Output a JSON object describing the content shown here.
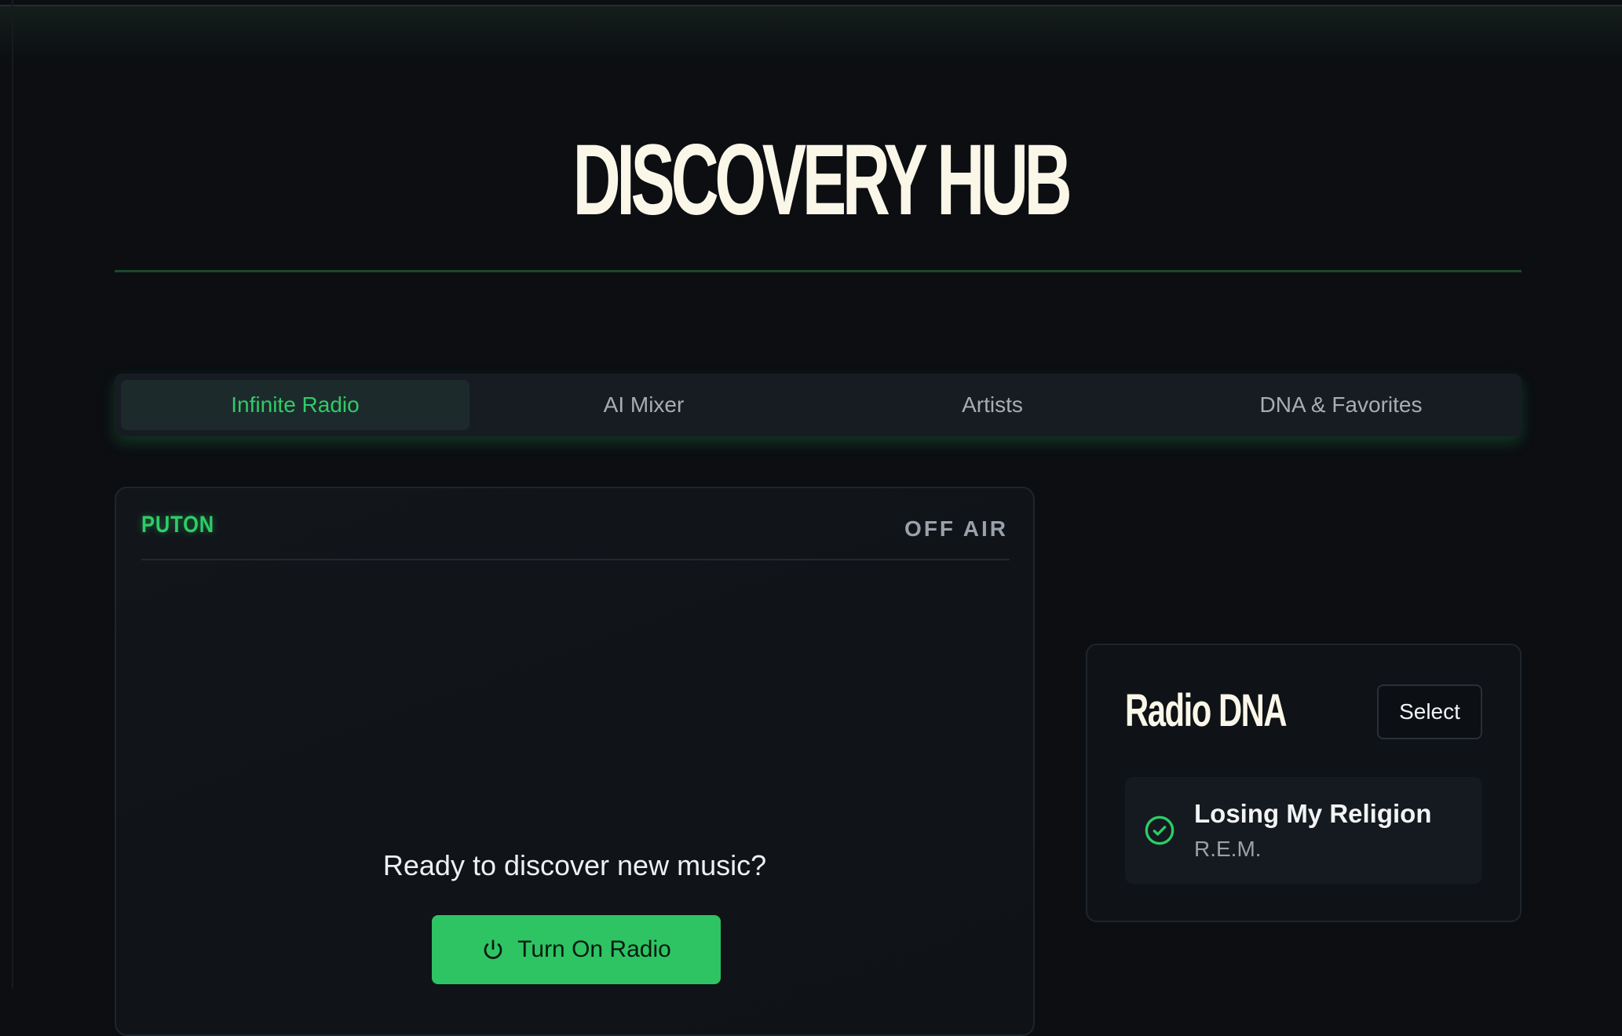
{
  "header": {
    "title": "DISCOVERY HUB"
  },
  "tabs": [
    {
      "label": "Infinite Radio",
      "active": true
    },
    {
      "label": "AI Mixer",
      "active": false
    },
    {
      "label": "Artists",
      "active": false
    },
    {
      "label": "DNA & Favorites",
      "active": false
    }
  ],
  "radio": {
    "station": "PUTON",
    "status": "OFF AIR",
    "prompt": "Ready to discover new music?",
    "button_label": "Turn On Radio",
    "button_icon": "power-icon"
  },
  "dna": {
    "title": "Radio DNA",
    "select_label": "Select",
    "tracks": [
      {
        "title": "Losing My Religion",
        "artist": "R.E.M.",
        "icon": "check-circle-icon"
      }
    ]
  },
  "colors": {
    "accent": "#2ecc68",
    "background": "#0c0e12",
    "title": "#fbf7e8"
  }
}
